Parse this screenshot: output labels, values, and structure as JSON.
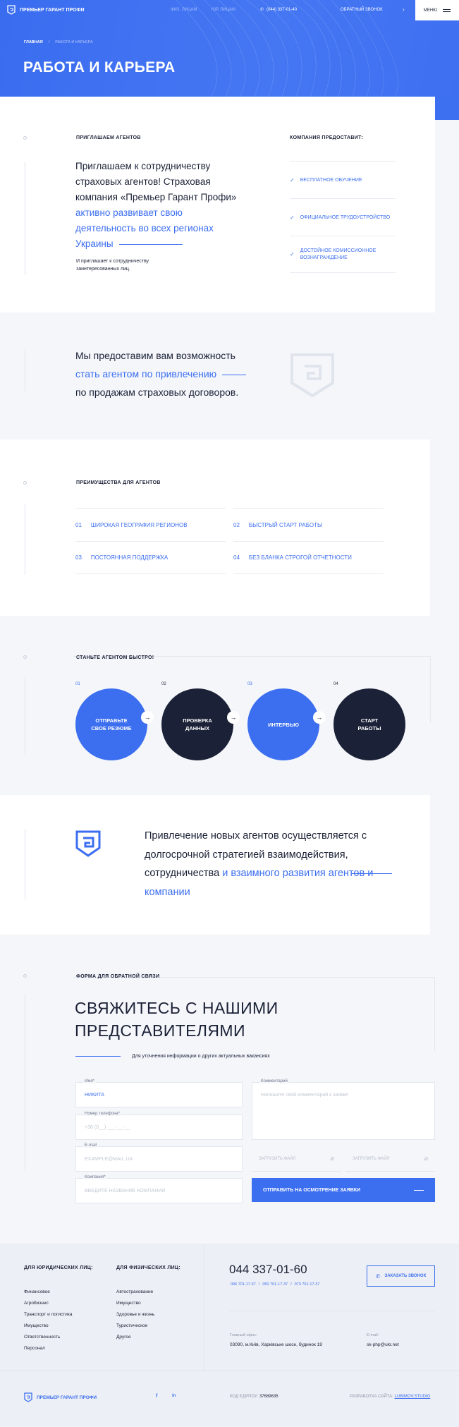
{
  "header": {
    "logo_text": "ПРЕМЬЕР ГАРАНТ ПРОФИ",
    "nav": [
      "ФИЗ. ЛИЦАМ",
      "ЮР. ЛИЦАМ"
    ],
    "phone": "(044) 337-01-40",
    "callback": "ОБРАТНЫЙ ЗВОНОК",
    "menu": "МЕНЮ"
  },
  "hero": {
    "breadcrumb_home": "ГЛАВНАЯ",
    "breadcrumb_current": "РАБОТА И КАРЬЕРА",
    "title": "РАБОТА И КАРЬЕРА"
  },
  "invite": {
    "label": "ПРИГЛАШАЕМ АГЕНТОВ",
    "text_dark": "Приглашаем к сотрудничеству страховых агентов! Страховая компания «Премьер Гарант Профи»",
    "text_blue": "активно развивает свою деятельность во всех регионах Украины",
    "small": "И приглашает к сотрудничеству заинтересованных лиц.",
    "provides_label": "КОМПАНИЯ ПРЕДОСТАВИТ:",
    "provides": [
      "БЕСПЛАТНОЕ ОБУЧЕНИЕ",
      "ОФИЦИАЛЬНОЕ ТРУДОУСТРОЙСТВО",
      "ДОСТОЙНОЕ КОМИССИОННОЕ ВОЗНАГРАЖДЕНИЕ"
    ]
  },
  "opportunity": {
    "line1": "Мы предоставим вам возможность",
    "line2": "стать агентом по привлечению",
    "line3": "по продажам страховых договоров."
  },
  "advantages": {
    "label": "ПРЕИМУЩЕСТВА ДЛЯ АГЕНТОВ",
    "items": [
      {
        "num": "01",
        "text": "ШИРОКАЯ ГЕОГРАФИЯ РЕГИОНОВ"
      },
      {
        "num": "02",
        "text": "БЫСТРЫЙ СТАРТ РАБОТЫ"
      },
      {
        "num": "03",
        "text": "ПОСТОЯННАЯ ПОДДЕРЖКА"
      },
      {
        "num": "04",
        "text": "БЕЗ БЛАНКА СТРОГОЙ ОТЧЕТНОСТИ"
      }
    ]
  },
  "steps": {
    "label": "СТАНЬТЕ АГЕНТОМ БЫСТРО!",
    "items": [
      {
        "num": "01",
        "text": "ОТПРАВЬТЕ СВОЕ РЕЗЮМЕ"
      },
      {
        "num": "02",
        "text": "ПРОВЕРКА ДАННЫХ"
      },
      {
        "num": "03",
        "text": "ИНТЕРВЬЮ"
      },
      {
        "num": "04",
        "text": "СТАРТ РАБОТЫ"
      }
    ]
  },
  "strategy": {
    "text_dark": "Привлечение новых агентов осуществляется с долгосрочной стратегией взаимодействия, сотрудничества",
    "text_blue": "и взаимного развития агентов и компании"
  },
  "form": {
    "label": "ФОРМА ДЛЯ ОБРАТНОЙ СВЯЗИ",
    "title_l1": "СВЯЖИТЕСЬ С НАШИМИ",
    "title_l2": "ПРЕДСТАВИТЕЛЯМИ",
    "subtitle": "Для уточнения информации о других актуальных вакансиях",
    "name_label": "Имя*",
    "name_value": "НИКИТА",
    "phone_label": "Номер телефона*",
    "phone_placeholder": "+38 (0__) ___-__-__",
    "email_label": "E-mail",
    "email_placeholder": "EXAMPLE@MAIL.UA",
    "company_label": "Компания*",
    "company_placeholder": "ВВЕДИТЕ НАЗВАНИЕ КОМПАНИИ",
    "comment_label": "Комментарий",
    "comment_placeholder": "Напишите свой комментарий к заявке",
    "upload1": "ЗАГРУЗИТЬ ФАЙЛ",
    "upload2": "ЗАГРУЗИТЬ ФАЙЛ",
    "submit": "ОТПРАВИТЬ НА ОСМОТРЕНИЕ ЗАЯВКИ"
  },
  "footer": {
    "col1_title": "ДЛЯ ЮРИДИЧЕСКИХ ЛИЦ:",
    "col1": [
      "Финансовое",
      "Агробизнес",
      "Транспорт и логистика",
      "Имущество",
      "Ответственность",
      "Персонал"
    ],
    "col2_title": "ДЛЯ ФИЗИЧЕСКИХ ЛИЦ:",
    "col2": [
      "Автострахование",
      "Имущество",
      "Здоровье и жизнь",
      "Туристическое",
      "Другое"
    ],
    "phone": "044 337-01-60",
    "phones_small": [
      "096 701-17-37",
      "050 701-17-37",
      "073 701-17-37"
    ],
    "callback": "ЗАКАЗАТЬ ЗВОНОК",
    "office_label": "Главный офис:",
    "office": "03090, м.Київ, Харківське шосе, будинок 19",
    "email_label": "E-mail:",
    "email": "sk-php@ukr.net",
    "logo_text": "ПРЕМЬЕР ГАРАНТ ПРОФИ",
    "social": [
      "f",
      "in"
    ],
    "edrpou_label": "КОД ЄДРПОУ:",
    "edrpou": "37689635",
    "dev_label": "РАЗРАБОТКА САЙТА:",
    "dev": "LUBIMOV.STUDIO"
  },
  "colors": {
    "accent": "#3c6ef0",
    "dark": "#1b2136",
    "bg": "#f4f6fa"
  }
}
